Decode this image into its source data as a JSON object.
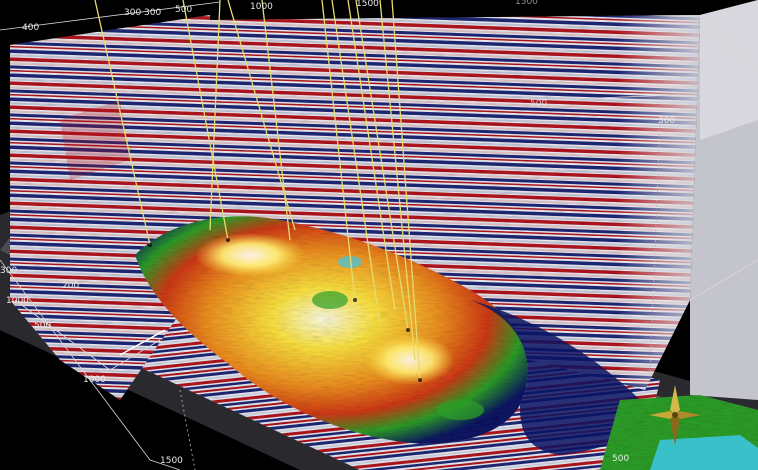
{
  "axis_labels": {
    "top_left_400": "400",
    "top_300a": "300",
    "top_300b": "300",
    "top_500": "500",
    "top_1000": "1000",
    "top_1500": "1500",
    "top_right_1500": "1500",
    "left_300": "300",
    "left_1000": "1000",
    "left_200": "200",
    "left_500": "500",
    "left_1000b": "1000",
    "bottom_1500": "1500",
    "right_300": "300",
    "right_500": "500",
    "right_top_500": "500"
  },
  "colors": {
    "background": "#000000",
    "seismic_red": "#b4141e",
    "seismic_blue": "#1e2878",
    "seismic_white": "#f0f0f5",
    "well_line": "#e6dc6e",
    "amplitude_low": "#0a1464",
    "amplitude_mid": "#2da028",
    "amplitude_high": "#ffe640",
    "amplitude_peak": "#ffffe6"
  },
  "icons": {
    "compass": "north-arrow-compass-icon"
  }
}
